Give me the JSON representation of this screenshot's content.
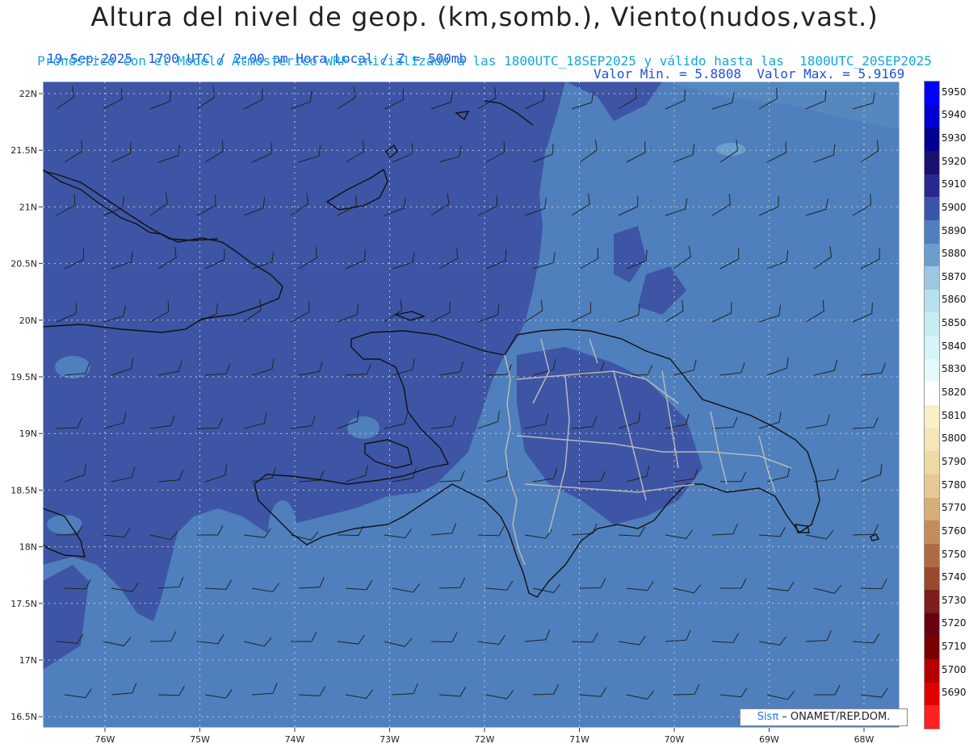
{
  "header": {
    "title": "Altura del nivel de geop. (km,somb.), Viento(nudos,vast.)",
    "date_line": "19-Sep-2025  1700 UTC / 2:00 pm Hora Local / Z = 500mb",
    "minmax_line": "Valor Min. = 5.8808  Valor Max. = 5.9169",
    "model_line": "Pronóstico con el Modelo Atmosferico WRF inicializado a las 1800UTC_18SEP2025 y válido hasta las  1800UTC_20SEP2025"
  },
  "axes": {
    "lat_labels": [
      "22N",
      "21.5N",
      "21N",
      "20.5N",
      "20N",
      "19.5N",
      "19N",
      "18.5N",
      "18N",
      "17.5N",
      "17N",
      "16.5N"
    ],
    "lon_labels": [
      "76W",
      "75W",
      "74W",
      "73W",
      "72W",
      "71W",
      "70W",
      "69W",
      "68W"
    ]
  },
  "colorbar": {
    "levels": [
      "5950",
      "5940",
      "5930",
      "5920",
      "5910",
      "5900",
      "5890",
      "5880",
      "5870",
      "5860",
      "5850",
      "5840",
      "5830",
      "5820",
      "5810",
      "5800",
      "5790",
      "5780",
      "5770",
      "5760",
      "5750",
      "5740",
      "5730",
      "5720",
      "5710",
      "5700",
      "5690"
    ],
    "colors": [
      "#0000ff",
      "#0000d0",
      "#000090",
      "#1a1070",
      "#28288e",
      "#3a55a8",
      "#4f7fbe",
      "#6a9ecd",
      "#9ec6e2",
      "#b6e0ee",
      "#c6ecf4",
      "#d6f4f8",
      "#e4fafc",
      "#ffffff",
      "#faf0c8",
      "#f4e6b8",
      "#eed8a4",
      "#e6c896",
      "#d6ae78",
      "#c48c58",
      "#b06a44",
      "#9a4830",
      "#7c1e1e",
      "#680010",
      "#7a0000",
      "#b40000",
      "#e00000",
      "#ff2020"
    ]
  },
  "colors": {
    "field_high": "#3d55a4",
    "field_mid": "#4f80bd",
    "field_low": "#6a9ecd",
    "coast": "#111111",
    "borders": "#b8b8b8"
  },
  "credit": {
    "brand": "Sisπ",
    "text": " – ONAMET/REP.DOM."
  }
}
